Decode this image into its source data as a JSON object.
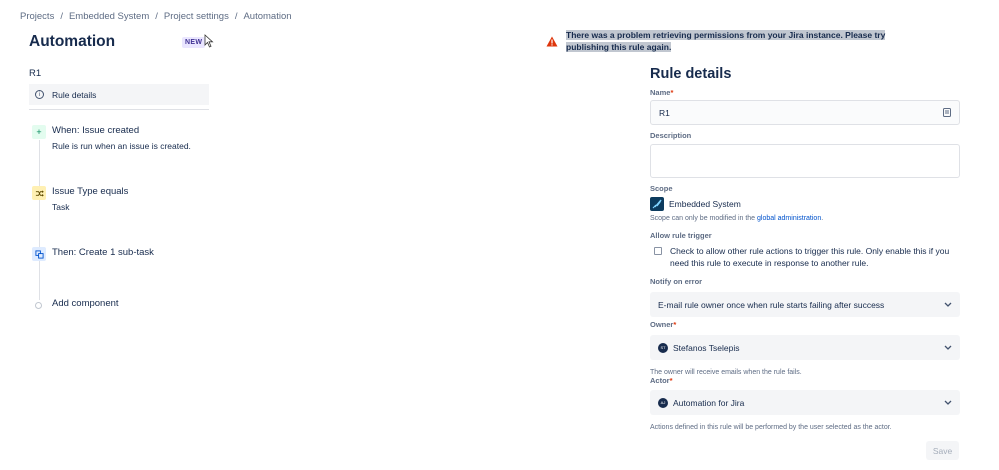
{
  "breadcrumb": [
    "Projects",
    "Embedded System",
    "Project settings",
    "Automation"
  ],
  "page": {
    "title": "Automation",
    "new_badge": "NEW"
  },
  "rule": {
    "name": "R1",
    "details_item": "Rule details",
    "components": [
      {
        "type": "trigger",
        "title": "When: Issue created",
        "subtitle": "Rule is run when an issue is created.",
        "icon": "plus-icon"
      },
      {
        "type": "condition",
        "title": "Issue Type equals",
        "subtitle": "Task",
        "icon": "shuffle-icon"
      },
      {
        "type": "action",
        "title": "Then: Create 1 sub-task",
        "subtitle": "",
        "icon": "subtask-icon"
      }
    ],
    "add_component": "Add component"
  },
  "error": {
    "message": "There was a problem retrieving permissions from your Jira instance. Please try publishing this rule again.",
    "icon": "warning-icon",
    "color": "#de350b"
  },
  "details": {
    "title": "Rule details",
    "name_label": "Name",
    "name_value": "R1",
    "description_label": "Description",
    "scope_label": "Scope",
    "scope_value": "Embedded System",
    "scope_helper_prefix": "Scope can only be modified in the ",
    "scope_helper_link": "global administration",
    "scope_helper_suffix": ".",
    "allow_trigger_label": "Allow rule trigger",
    "allow_trigger_text": "Check to allow other rule actions to trigger this rule. Only enable this if you need this rule to execute in response to another rule.",
    "notify_label": "Notify on error",
    "notify_value": "E-mail rule owner once when rule starts failing after success",
    "owner_label": "Owner",
    "owner_value": "Stefanos Tselepis",
    "owner_initials": "ST",
    "owner_helper": "The owner will receive emails when the rule fails.",
    "actor_label": "Actor",
    "actor_value": "Automation for Jira",
    "actor_initials": "AJ",
    "actor_helper": "Actions defined in this rule will be performed by the user selected as the actor.",
    "required_mark": "*",
    "save_label": "Save"
  }
}
